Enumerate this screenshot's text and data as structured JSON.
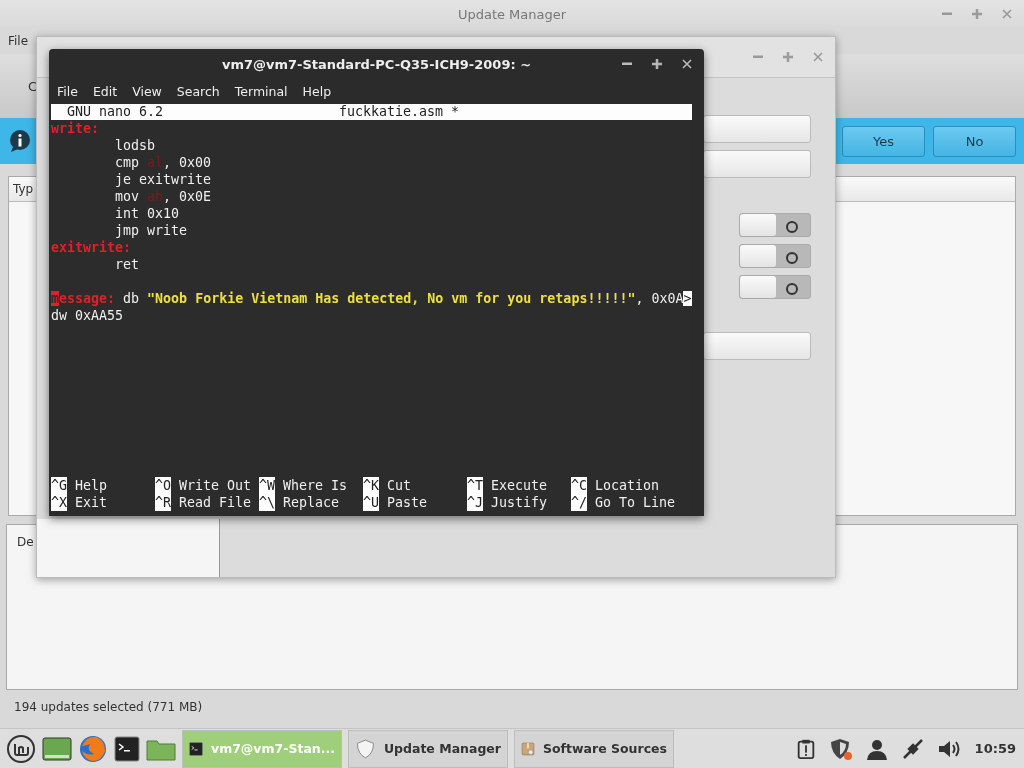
{
  "update_manager": {
    "title": "Update Manager",
    "menu": [
      "File"
    ],
    "toolbar_text": "C",
    "info_bar": {
      "buttons": [
        "Yes",
        "No"
      ]
    },
    "table": {
      "columns": [
        "Typ"
      ]
    },
    "details_tab": "De",
    "status_bar": "194 updates selected (771 MB)"
  },
  "software_sources": {
    "switches": [
      {
        "on": false
      },
      {
        "on": false
      },
      {
        "on": false
      }
    ]
  },
  "terminal": {
    "title": "vm7@vm7-Standard-PC-Q35-ICH9-2009: ~",
    "menu": [
      "File",
      "Edit",
      "View",
      "Search",
      "Terminal",
      "Help"
    ],
    "nano": {
      "version": "GNU nano 6.2",
      "filename": "fuckkatie.asm *",
      "lines": [
        {
          "segments": [
            {
              "kind": "label",
              "text": "write:"
            }
          ]
        },
        {
          "segments": [
            {
              "kind": "code",
              "text": "\tlodsb"
            }
          ]
        },
        {
          "segments": [
            {
              "kind": "code",
              "text": "\tcmp "
            },
            {
              "kind": "register",
              "text": "al"
            },
            {
              "kind": "code",
              "text": ", 0x00"
            }
          ]
        },
        {
          "segments": [
            {
              "kind": "code",
              "text": "\tje exitwrite"
            }
          ]
        },
        {
          "segments": [
            {
              "kind": "code",
              "text": "\tmov "
            },
            {
              "kind": "register",
              "text": "ah"
            },
            {
              "kind": "code",
              "text": ", 0x0E"
            }
          ]
        },
        {
          "segments": [
            {
              "kind": "code",
              "text": "\tint 0x10"
            }
          ]
        },
        {
          "segments": [
            {
              "kind": "code",
              "text": "\tjmp write"
            }
          ]
        },
        {
          "segments": [
            {
              "kind": "label",
              "text": "exitwrite:"
            }
          ]
        },
        {
          "segments": [
            {
              "kind": "code",
              "text": "\tret"
            }
          ]
        },
        {
          "blank_before": true,
          "segments": [
            {
              "kind": "cursor",
              "text": "m"
            },
            {
              "kind": "label",
              "text": "essage:"
            },
            {
              "kind": "code",
              "text": " db "
            },
            {
              "kind": "string",
              "text": "\"Noob Forkie Vietnam Has detected, No vm for you retaps!!!!!\""
            },
            {
              "kind": "code",
              "text": ", 0x0A"
            },
            {
              "kind": "overflow",
              "text": ">"
            }
          ]
        },
        {
          "segments": [
            {
              "kind": "code",
              "text": "dw 0xAA55"
            }
          ]
        }
      ],
      "shortcuts": [
        {
          "key": "^G",
          "label": "Help"
        },
        {
          "key": "^O",
          "label": "Write Out"
        },
        {
          "key": "^W",
          "label": "Where Is"
        },
        {
          "key": "^K",
          "label": "Cut"
        },
        {
          "key": "^T",
          "label": "Execute"
        },
        {
          "key": "^C",
          "label": "Location"
        },
        {
          "key": "^X",
          "label": "Exit"
        },
        {
          "key": "^R",
          "label": "Read File"
        },
        {
          "key": "^\\",
          "label": "Replace"
        },
        {
          "key": "^U",
          "label": "Paste"
        },
        {
          "key": "^J",
          "label": "Justify"
        },
        {
          "key": "^/",
          "label": "Go To Line"
        }
      ]
    }
  },
  "taskbar": {
    "tasks": [
      {
        "label": "vm7@vm7-Stan...",
        "kind": "terminal",
        "selected": true
      },
      {
        "label": "Update Manager",
        "kind": "shield",
        "selected": false
      },
      {
        "label": "Software Sources",
        "kind": "package",
        "selected": false
      }
    ],
    "clock": "10:59"
  }
}
